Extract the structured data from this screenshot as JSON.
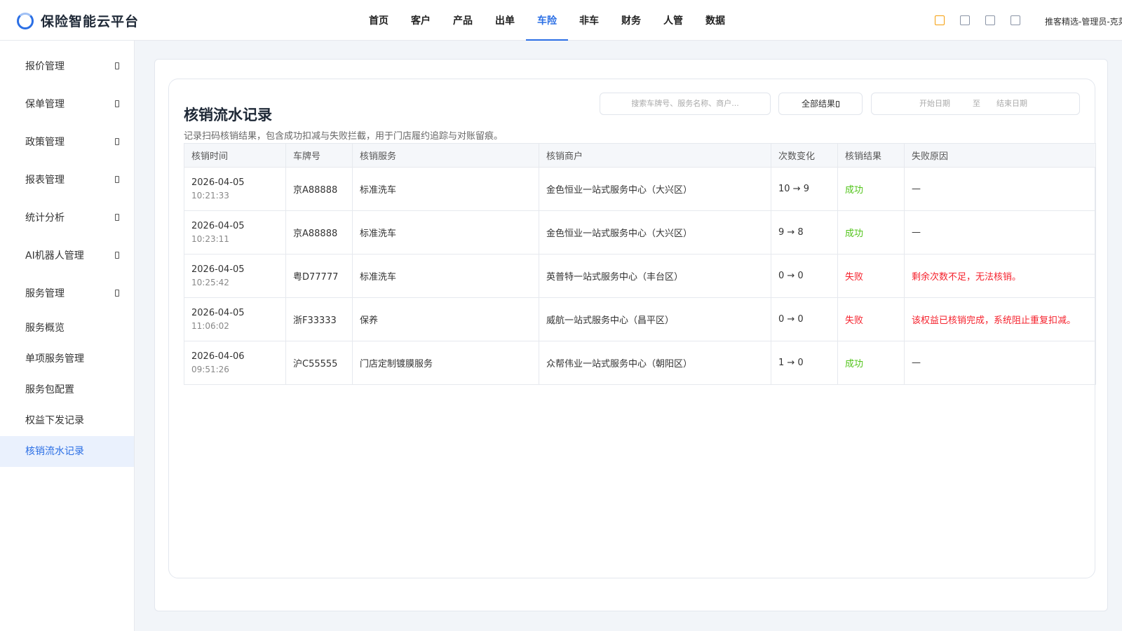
{
  "brand": {
    "name": "保险智能云平台"
  },
  "nav": {
    "items": [
      "首页",
      "客户",
      "产品",
      "出单",
      "车险",
      "非车",
      "财务",
      "人管",
      "数据"
    ],
    "active": "车险"
  },
  "header": {
    "user": "推客精选-管理员-克莱"
  },
  "sidebar": {
    "groups": [
      {
        "label": "报价管理"
      },
      {
        "label": "保单管理"
      },
      {
        "label": "政策管理"
      },
      {
        "label": "报表管理"
      },
      {
        "label": "统计分析"
      },
      {
        "label": "AI机器人管理"
      },
      {
        "label": "服务管理"
      }
    ],
    "subitems": [
      {
        "label": "服务概览"
      },
      {
        "label": "单项服务管理"
      },
      {
        "label": "服务包配置"
      },
      {
        "label": "权益下发记录"
      },
      {
        "label": "核销流水记录"
      }
    ],
    "active": "核销流水记录"
  },
  "page": {
    "title": "核销流水记录",
    "desc": "记录扫码核销结果，包含成功扣减与失败拦截，用于门店履约追踪与对账留痕。",
    "search_placeholder": "搜索车牌号、服务名称、商户...",
    "filter_label": "全部结果",
    "date_start": "开始日期",
    "date_sep": "至",
    "date_end": "结束日期"
  },
  "table": {
    "columns": [
      "核销时间",
      "车牌号",
      "核销服务",
      "核销商户",
      "次数变化",
      "核销结果",
      "失败原因"
    ],
    "rows": [
      {
        "date": "2026-04-05",
        "time": "10:21:33",
        "plate": "京A88888",
        "service": "标准洗车",
        "merchant": "金色恒业一站式服务中心（大兴区）",
        "change": "10 → 9",
        "result": "成功",
        "reason": "—"
      },
      {
        "date": "2026-04-05",
        "time": "10:23:11",
        "plate": "京A88888",
        "service": "标准洗车",
        "merchant": "金色恒业一站式服务中心（大兴区）",
        "change": "9 → 8",
        "result": "成功",
        "reason": "—"
      },
      {
        "date": "2026-04-05",
        "time": "10:25:42",
        "plate": "粤D77777",
        "service": "标准洗车",
        "merchant": "英普特一站式服务中心（丰台区）",
        "change": "0 → 0",
        "result": "失败",
        "reason": "剩余次数不足，无法核销。"
      },
      {
        "date": "2026-04-05",
        "time": "11:06:02",
        "plate": "浙F33333",
        "service": "保养",
        "merchant": "威航一站式服务中心（昌平区）",
        "change": "0 → 0",
        "result": "失败",
        "reason": "该权益已核销完成，系统阻止重复扣减。"
      },
      {
        "date": "2026-04-06",
        "time": "09:51:26",
        "plate": "沪C55555",
        "service": "门店定制镀膜服务",
        "merchant": "众帮伟业一站式服务中心（朝阳区）",
        "change": "1 → 0",
        "result": "成功",
        "reason": "—"
      }
    ]
  },
  "colors": {
    "accent": "#2b6fe5",
    "success": "#52c41a",
    "danger": "#f5222d"
  }
}
